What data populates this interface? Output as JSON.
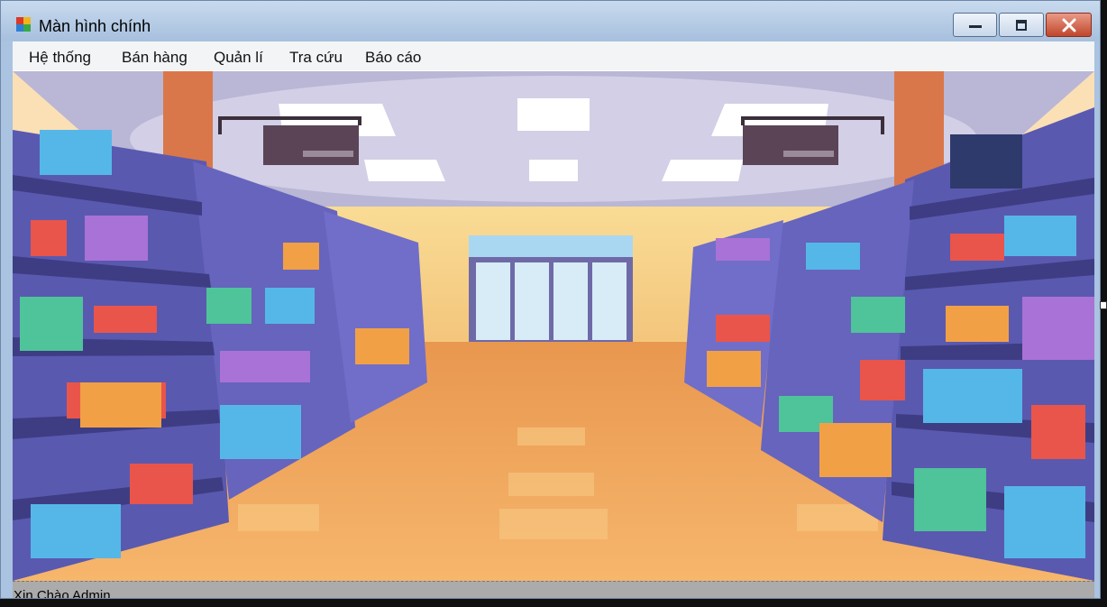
{
  "window": {
    "title": "Màn hình chính",
    "controls": {
      "minimize": "minimize-icon",
      "maximize": "maximize-icon",
      "close": "close-icon"
    }
  },
  "menu": [
    {
      "label": "Hệ thống"
    },
    {
      "label": "Bán hàng"
    },
    {
      "label": "Quản lí"
    },
    {
      "label": "Tra cứu"
    },
    {
      "label": "Báo cáo"
    }
  ],
  "background_image": {
    "subject": "supermarket-aisle-illustration"
  },
  "status": {
    "text": "Xin Chào Admin"
  },
  "colors": {
    "titlebar": "#a7c0de",
    "close_button": "#c0462c",
    "floor": "#f1a55e",
    "shelf": "#5a59b0",
    "wall": "#f6d38a",
    "statusbar": "#ababab"
  }
}
